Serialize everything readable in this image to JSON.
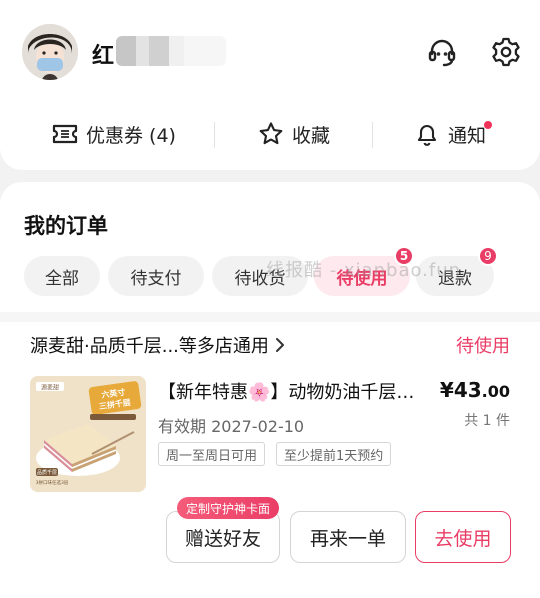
{
  "profile": {
    "username": "红"
  },
  "header_icons": {
    "service": "headset-icon",
    "settings": "gear-icon"
  },
  "quick_links": {
    "coupons_label": "优惠券 (4)",
    "favorites_label": "收藏",
    "notifications_label": "通知"
  },
  "orders": {
    "title": "我的订单",
    "watermark": "线报酷 - xianbao.fun",
    "tabs": [
      {
        "label": "全部",
        "badge": ""
      },
      {
        "label": "待支付",
        "badge": ""
      },
      {
        "label": "待收货",
        "badge": ""
      },
      {
        "label": "待使用",
        "badge": "5"
      },
      {
        "label": "退款",
        "badge": "9"
      }
    ],
    "active_tab": "待使用"
  },
  "order": {
    "store": "源麦甜·品质千层...等多店通用",
    "status": "待使用",
    "product_title": "【新年特惠🌸】动物奶油千层…",
    "price_int": "¥43",
    "price_dec": ".00",
    "quantity": "共 1 件",
    "validity": "有效期 2027-02-10",
    "tags": [
      "周一至周日可用",
      "至少提前1天预约"
    ],
    "promo_label": "定制守护神卡面",
    "buttons": {
      "gift": "赠送好友",
      "reorder": "再来一单",
      "use": "去使用"
    }
  },
  "product_image": {
    "brand": "源麦甜",
    "headline_1": "六英寸",
    "headline_2": "三拼千层",
    "label": "品质千层",
    "sub": "3拼口味任选3层"
  },
  "colors": {
    "accent": "#ea3d66",
    "accent_light": "#fde9ee",
    "background": "#f2f2f2"
  }
}
